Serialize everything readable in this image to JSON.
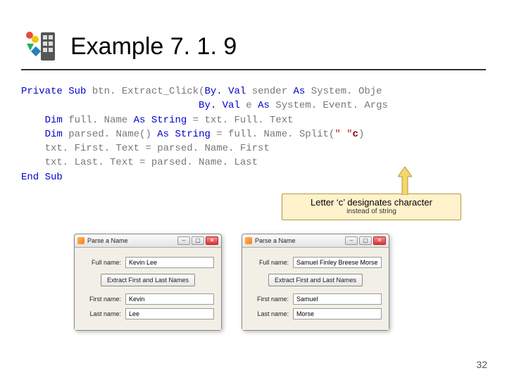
{
  "slide": {
    "title": "Example 7. 1. 9",
    "page_number": "32"
  },
  "code": {
    "line1": {
      "private": "Private",
      "sub": "Sub",
      "name": "btn. Extract_Click(",
      "byval1": "By. Val",
      "sender": " sender ",
      "as1": "As",
      "sysobj": " System. Obje"
    },
    "line2": {
      "byval2": "By. Val",
      "e": " e ",
      "as2": "As",
      "evtargs": " System. Event. Args"
    },
    "line3": {
      "dim": "Dim",
      "decl": " full. Name ",
      "as": "As",
      "type": " String",
      "eq": " = txt. Full. Text"
    },
    "line4": {
      "dim": "Dim",
      "decl": " parsed. Name() ",
      "as": "As",
      "type": " String",
      "eq": " = full. Name. Split(",
      "str": "\" \"",
      "c": "c",
      "close": ")"
    },
    "line5": "    txt. First. Text = parsed. Name. First",
    "line6": "    txt. Last. Text = parsed. Name. Last",
    "line7": {
      "end": "End",
      "sub": "Sub"
    }
  },
  "callout": {
    "main": "Letter ‘c’ designates character",
    "sub": "instead of string"
  },
  "windows": [
    {
      "title": "Parse a Name",
      "fullname_label": "Full name:",
      "fullname_value": "Kevin Lee",
      "button": "Extract First and Last Names",
      "first_label": "First name:",
      "first_value": "Kevin",
      "last_label": "Last name:",
      "last_value": "Lee"
    },
    {
      "title": "Parse a Name",
      "fullname_label": "Full name:",
      "fullname_value": "Samuel Finley Breese Morse",
      "button": "Extract First and Last Names",
      "first_label": "First name:",
      "first_value": "Samuel",
      "last_label": "Last name:",
      "last_value": "Morse"
    }
  ]
}
